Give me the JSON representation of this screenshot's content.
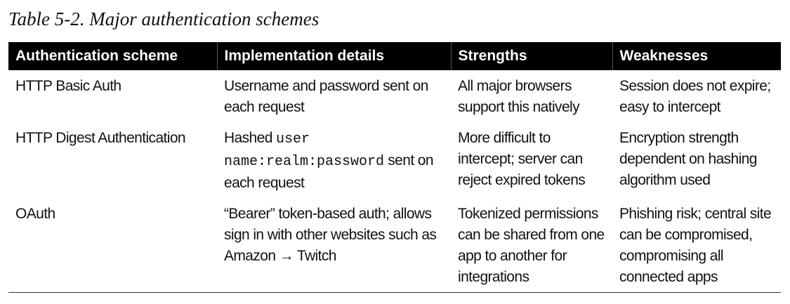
{
  "caption": "Table 5-2. Major authentication schemes",
  "headers": {
    "scheme": "Authentication scheme",
    "implementation": "Implementation details",
    "strengths": "Strengths",
    "weaknesses": "Weaknesses"
  },
  "rows": [
    {
      "scheme": "HTTP Basic Auth",
      "implementation": "Username and password sent on each request",
      "strengths": "All major browsers support this natively",
      "weaknesses": "Session does not expire; easy to intercept"
    },
    {
      "scheme": "HTTP Digest Authentication",
      "implementation_prefix": "Hashed ",
      "implementation_code_1": "user",
      "implementation_code_2": "name:realm:password",
      "implementation_suffix": " sent on each request",
      "strengths": "More difficult to intercept; server can reject expired tokens",
      "weaknesses": "Encryption strength dependent on hashing algorithm used"
    },
    {
      "scheme": "OAuth",
      "implementation": "“Bearer” token-based auth; allows sign in with other websites such as Amazon → Twitch",
      "strengths": "Tokenized permissions can be shared from one app to another for integrations",
      "weaknesses": "Phishing risk; central site can be compromised, compromising all connected apps"
    }
  ]
}
